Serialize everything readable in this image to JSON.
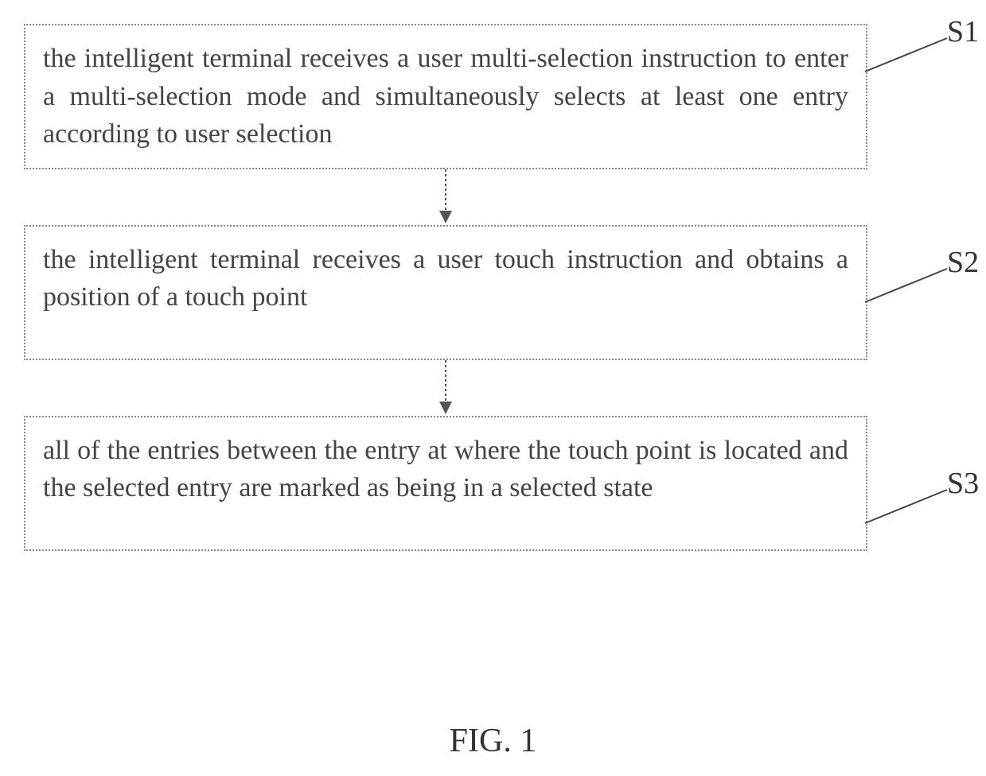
{
  "steps": [
    {
      "id": "S1",
      "text": "the intelligent terminal receives a user multi-selection instruction to enter a multi-selection mode and simultaneously selects at least one entry according to user selection"
    },
    {
      "id": "S2",
      "text": "the intelligent terminal receives a user touch instruction and obtains a position of a touch point"
    },
    {
      "id": "S3",
      "text": "all of the entries between the entry at where the touch point is located and the selected entry are marked as being in a selected state"
    }
  ],
  "caption": "FIG. 1"
}
